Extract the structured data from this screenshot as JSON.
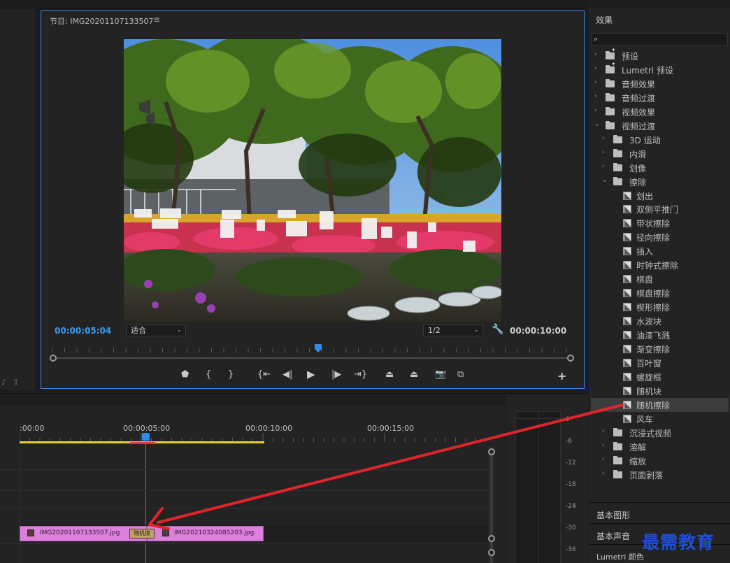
{
  "program_monitor": {
    "title": "节目: IMG20201107133507",
    "menu_icon": "≡",
    "timecode_current": "00:00:05:04",
    "fit": "适合",
    "resolution": "1/2",
    "timecode_duration": "00:00:10:00",
    "add": "+"
  },
  "effects": {
    "title": "效果",
    "search_placeholder": "",
    "tree": [
      {
        "label": "预设"
      },
      {
        "label": "Lumetri 预设"
      },
      {
        "label": "音频效果"
      },
      {
        "label": "音频过渡"
      },
      {
        "label": "视频效果"
      },
      {
        "label": "视频过渡"
      },
      {
        "label": "3D 运动"
      },
      {
        "label": "内滑"
      },
      {
        "label": "划像"
      },
      {
        "label": "擦除"
      },
      {
        "label": "划出"
      },
      {
        "label": "双侧平推门"
      },
      {
        "label": "带状擦除"
      },
      {
        "label": "径向擦除"
      },
      {
        "label": "插入"
      },
      {
        "label": "时钟式擦除"
      },
      {
        "label": "棋盘"
      },
      {
        "label": "棋盘擦除"
      },
      {
        "label": "楔形擦除"
      },
      {
        "label": "水波块"
      },
      {
        "label": "油漆飞溅"
      },
      {
        "label": "渐变擦除"
      },
      {
        "label": "百叶窗"
      },
      {
        "label": "螺旋框"
      },
      {
        "label": "随机块"
      },
      {
        "label": "随机擦除"
      },
      {
        "label": "风车"
      },
      {
        "label": "沉浸式视频"
      },
      {
        "label": "溶解"
      },
      {
        "label": "缩放"
      },
      {
        "label": "页面剥落"
      }
    ],
    "selected": "随机擦除"
  },
  "panels": {
    "basic_graphics": "基本图形",
    "basic_sound": "基本声音",
    "lumetri_color": "Lumetri 颜色"
  },
  "timeline": {
    "timecodes": [
      ":00:00",
      "00:00:05:00",
      "00:00:10:00",
      "00:00:15:00"
    ],
    "clips": [
      {
        "name": "IMG20201107133507.jpg"
      },
      {
        "name": "IMG20210324085203.jpg"
      }
    ],
    "transition_label": "随机擦"
  },
  "meter": {
    "db_labels": [
      "0",
      "-6",
      "-12",
      "-18",
      "-24",
      "-30",
      "-36"
    ]
  },
  "watermark": "最需教育",
  "colors": {
    "accent": "#2d8ceb",
    "clip": "#dc80dc",
    "work_area": "#e6d23a",
    "arrow": "#e2242a",
    "watermark": "#1f4fd8"
  }
}
